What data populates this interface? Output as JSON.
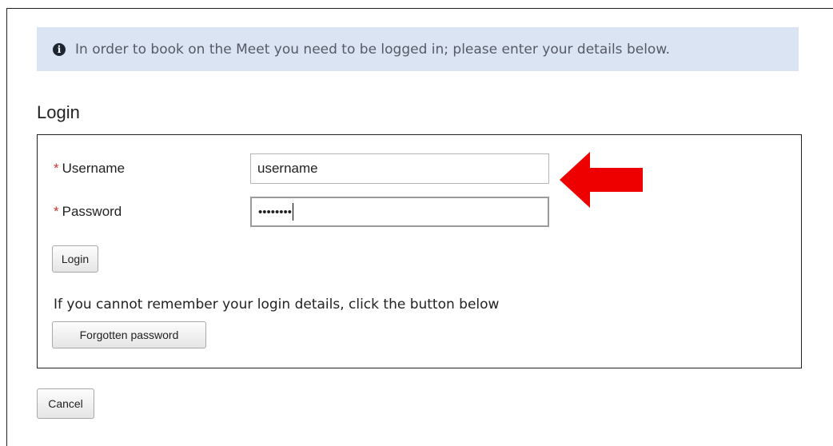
{
  "info": {
    "icon": "info-icon",
    "message": "In order to book on the Meet you need to be logged in; please enter your details below."
  },
  "login": {
    "heading": "Login",
    "username_label": "Username",
    "username_value": "username",
    "password_label": "Password",
    "password_value": "••••••••",
    "required_marker": "*",
    "login_button": "Login",
    "help_text": "If you cannot remember your login details, click the button below",
    "forgot_button": "Forgotten password"
  },
  "cancel_button": "Cancel",
  "colors": {
    "info_bg": "#dbe4f3",
    "arrow": "#ee0000",
    "required": "#cc3333"
  }
}
